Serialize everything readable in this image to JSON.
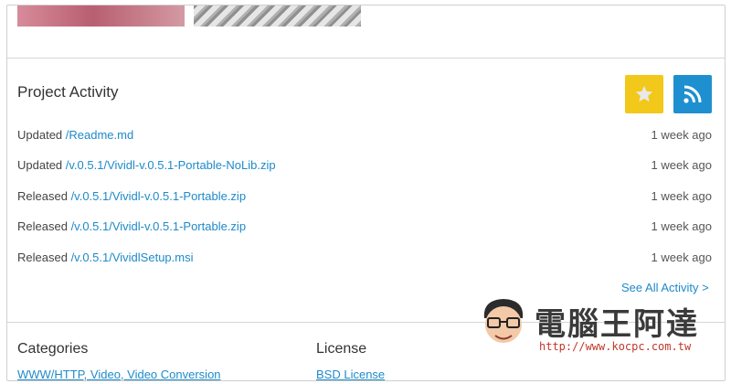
{
  "activity": {
    "title": "Project Activity",
    "items": [
      {
        "verb": "Updated",
        "path": "/Readme.md",
        "time": "1 week ago"
      },
      {
        "verb": "Updated",
        "path": "/v.0.5.1/Vividl-v.0.5.1-Portable-NoLib.zip",
        "time": "1 week ago"
      },
      {
        "verb": "Released",
        "path": "/v.0.5.1/Vividl-v.0.5.1-Portable.zip",
        "time": "1 week ago"
      },
      {
        "verb": "Released",
        "path": "/v.0.5.1/Vividl-v.0.5.1-Portable.zip",
        "time": "1 week ago"
      },
      {
        "verb": "Released",
        "path": "/v.0.5.1/VividlSetup.msi",
        "time": "1 week ago"
      }
    ],
    "see_all": "See All Activity >",
    "star_icon": "star-icon",
    "rss_icon": "rss-icon"
  },
  "categories": {
    "title": "Categories",
    "value": "WWW/HTTP, Video, Video Conversion"
  },
  "license": {
    "title": "License",
    "value": "BSD License"
  },
  "watermark": {
    "text": "電腦王阿達",
    "url": "http://www.kocpc.com.tw"
  },
  "colors": {
    "link": "#1e8ac9",
    "star_button": "#f2c81a",
    "rss_button": "#1e90d0"
  }
}
